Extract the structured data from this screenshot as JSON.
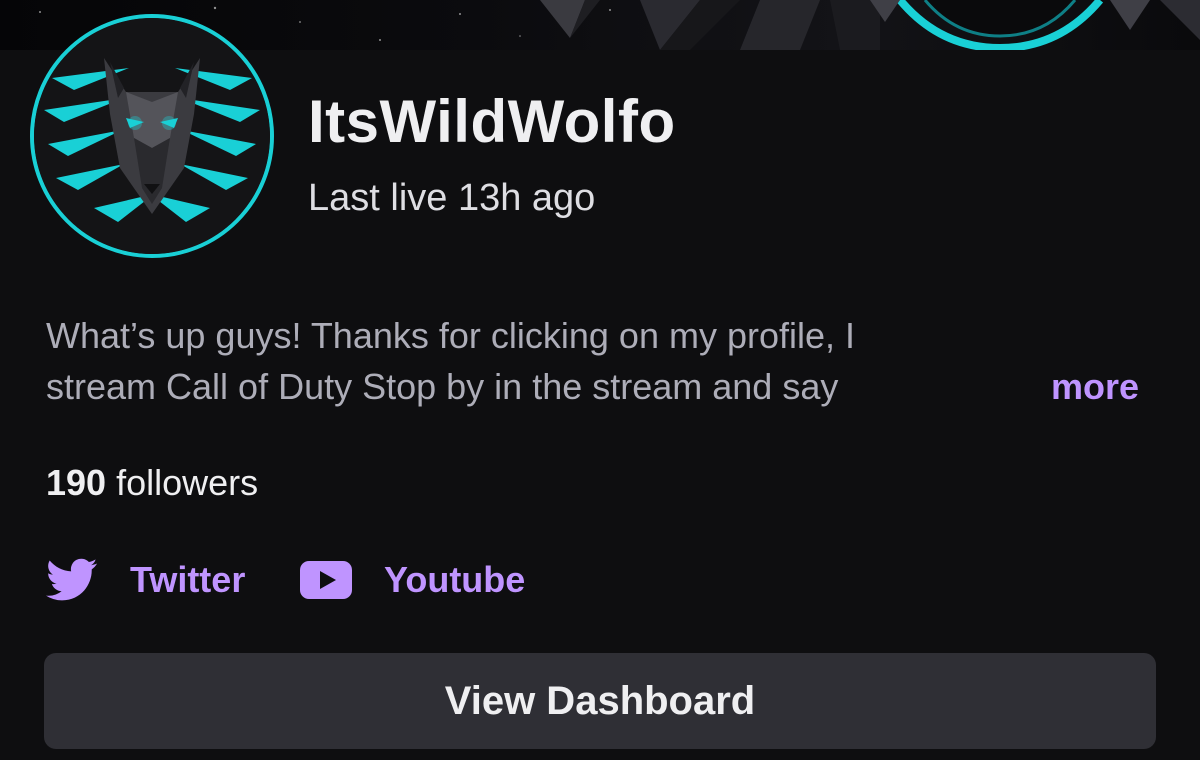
{
  "profile": {
    "display_name": "ItsWildWolfo",
    "last_live": "Last live 13h ago",
    "avatar_icon": "wolf-avatar-icon",
    "accent_color": "#19d0d6"
  },
  "bio": {
    "line1": "What’s up guys! Thanks for clicking on my profile, I",
    "line2": "stream Call of Duty Stop by in the stream and say",
    "more_label": "more"
  },
  "followers": {
    "count": "190",
    "label": "followers"
  },
  "social_links": {
    "twitter": {
      "label": "Twitter",
      "icon": "twitter-bird-icon"
    },
    "youtube": {
      "label": "Youtube",
      "icon": "youtube-play-icon"
    }
  },
  "actions": {
    "view_dashboard_label": "View Dashboard"
  },
  "colors": {
    "background": "#0e0e10",
    "link_purple": "#bf94ff",
    "button_bg": "#2f2f35",
    "muted_text": "#adadb8"
  }
}
